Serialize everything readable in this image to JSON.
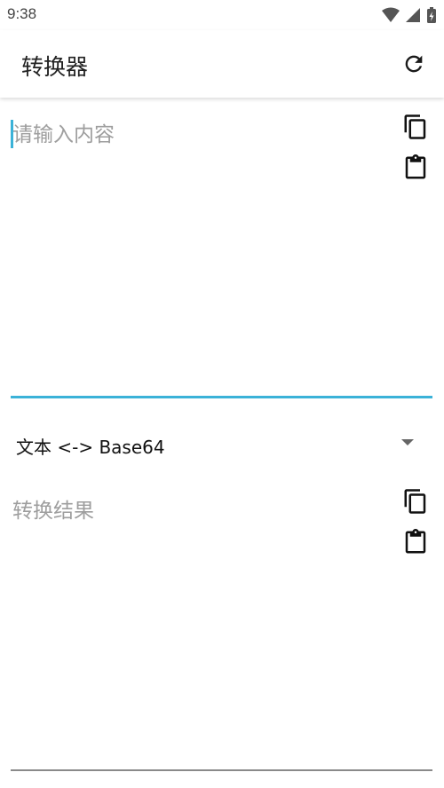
{
  "status_bar": {
    "time": "9:38",
    "icons": [
      "wifi-icon",
      "signal-icon",
      "battery-charging-icon"
    ]
  },
  "app_bar": {
    "title": "转换器",
    "action_icon": "refresh-icon"
  },
  "input": {
    "placeholder": "请输入内容",
    "value": "",
    "actions": [
      "copy-icon",
      "clipboard-paste-icon"
    ]
  },
  "mode_selector": {
    "selected": "文本 <-> Base64",
    "indicator_icon": "dropdown-arrow-icon"
  },
  "result": {
    "placeholder": "转换结果",
    "value": "",
    "actions": [
      "copy-icon",
      "clipboard-paste-icon"
    ]
  },
  "colors": {
    "accent": "#3bb2d8",
    "placeholder": "#9e9e9e",
    "icon": "#111111"
  }
}
